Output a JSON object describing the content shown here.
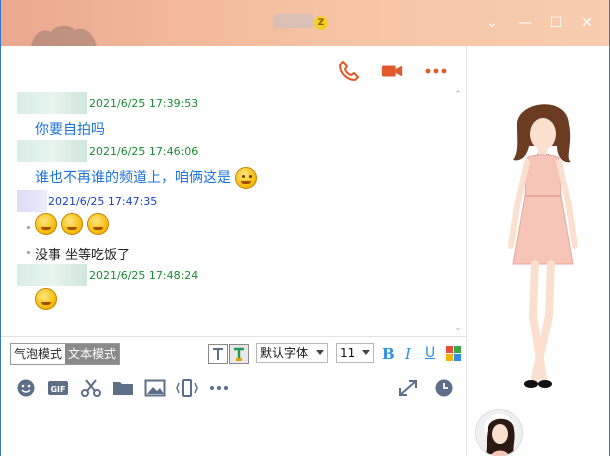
{
  "window": {
    "controls": {
      "dropdown": "⌄",
      "minimize": "—",
      "maximize": "☐",
      "close": "✕"
    },
    "badge_glyph": "Z"
  },
  "header_actions": [
    {
      "name": "voice-call-icon",
      "color": "#e05a2b"
    },
    {
      "name": "video-call-icon",
      "color": "#e05a2b"
    },
    {
      "name": "more-icon",
      "color": "#e05a2b"
    }
  ],
  "messages": [
    {
      "timestamp": "2021/6/25 17:39:53",
      "text": "你要自拍吗"
    },
    {
      "timestamp": "2021/6/25 17:46:06",
      "text": "谁也不再谁的频道上，咱俩这是"
    },
    {
      "timestamp": "2021/6/25 17:47:35",
      "text": "没事 坐等吃饭了"
    },
    {
      "timestamp": "2021/6/25 17:48:24",
      "text": ""
    }
  ],
  "toolbar": {
    "bubble_mode": "气泡模式",
    "text_mode": "文本模式",
    "font_family": "默认字体",
    "font_size": "11",
    "bold": "B",
    "italic": "I",
    "underline": "U"
  },
  "input_icons": [
    "emoji-icon",
    "gif-icon",
    "scissors-icon",
    "folder-icon",
    "image-icon",
    "shake-icon",
    "more-icon"
  ],
  "colors": {
    "accent": "#e05a2b",
    "timestamp": "#1c8a33",
    "self_text": "#1a73d8",
    "toolbar_icon": "#5c6f87"
  }
}
